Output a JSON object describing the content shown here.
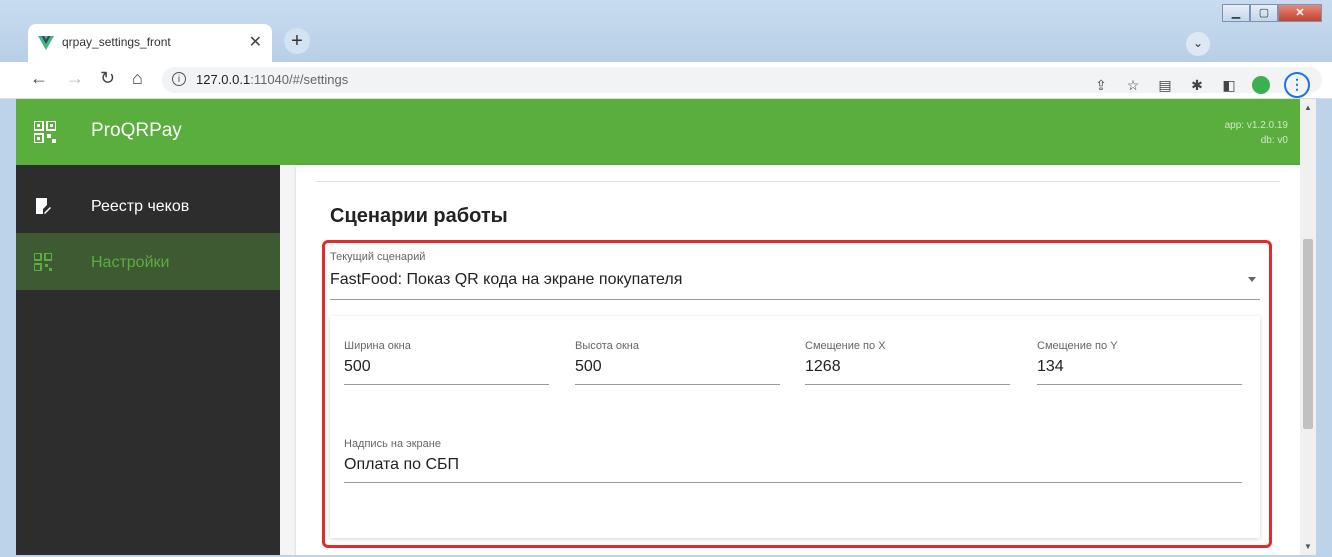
{
  "browser": {
    "tab_title": "qrpay_settings_front",
    "url_host": "127.0.0.1",
    "url_rest": ":11040/#/settings"
  },
  "app": {
    "title": "ProQRPay",
    "version_app": "app: v1.2.0.19",
    "version_db": "db: v0",
    "accent_color": "#5aae3d"
  },
  "sidebar": {
    "items": [
      {
        "label": "Реестр чеков",
        "icon": "receipt-icon",
        "active": false
      },
      {
        "label": "Настройки",
        "icon": "qr-settings-icon",
        "active": true
      }
    ]
  },
  "main": {
    "section_title": "Сценарии работы",
    "scenario": {
      "label": "Текущий сценарий",
      "value": "FastFood: Показ QR кода на экране покупателя"
    },
    "fields": {
      "width": {
        "label": "Ширина окна",
        "value": "500"
      },
      "height": {
        "label": "Высота окна",
        "value": "500"
      },
      "offset_x": {
        "label": "Смещение по X",
        "value": "1268"
      },
      "offset_y": {
        "label": "Смещение по Y",
        "value": "134"
      },
      "caption": {
        "label": "Надпись на экране",
        "value": "Оплата по СБП"
      }
    }
  }
}
